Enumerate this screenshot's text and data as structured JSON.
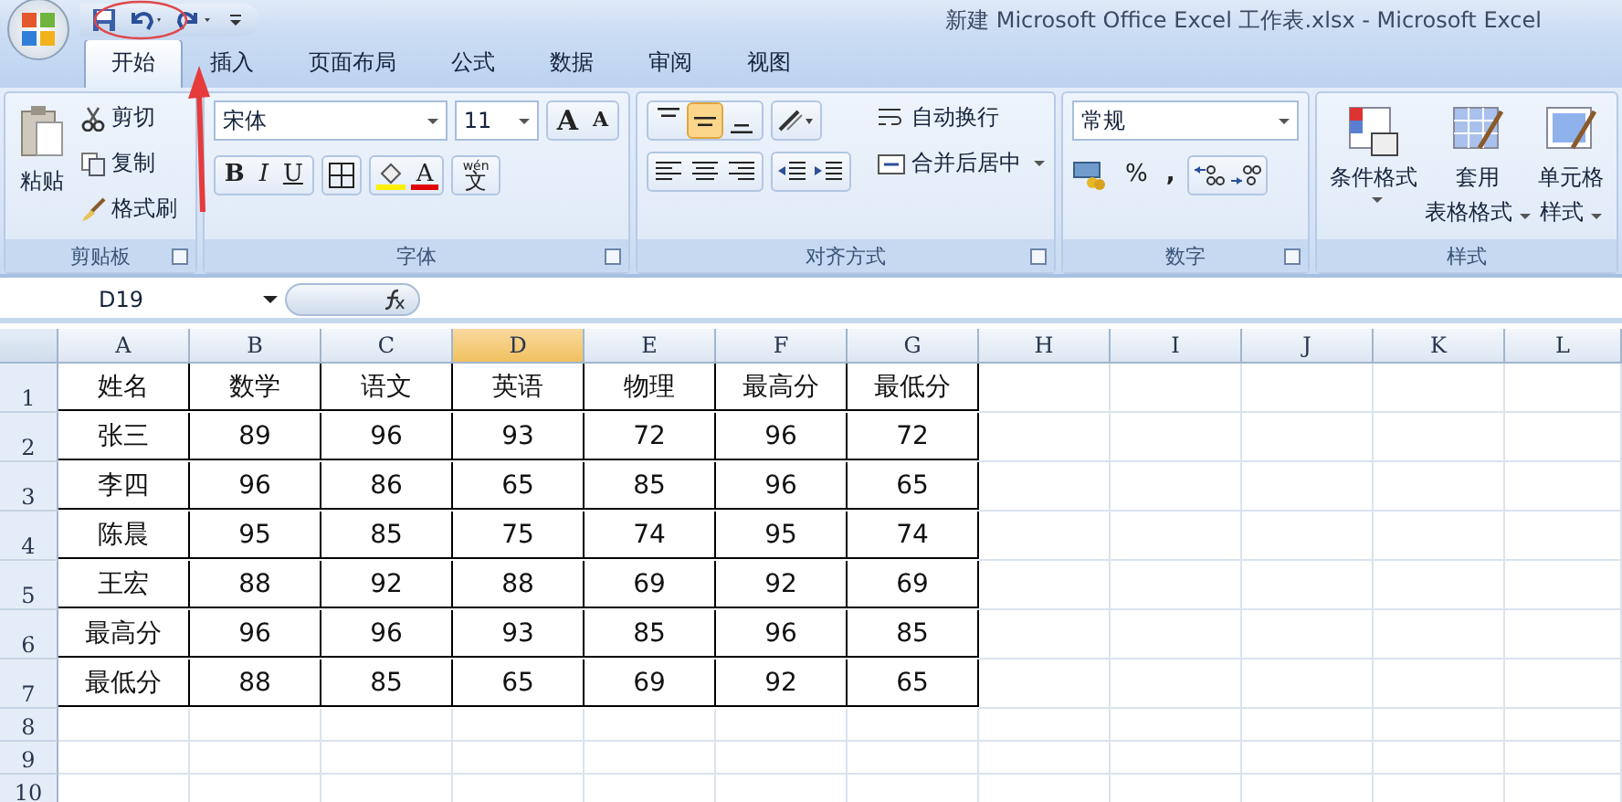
{
  "window": {
    "title": "新建 Microsoft Office Excel 工作表.xlsx - Microsoft Excel"
  },
  "tabs": [
    {
      "label": "开始",
      "selected": true
    },
    {
      "label": "插入",
      "selected": false
    },
    {
      "label": "页面布局",
      "selected": false
    },
    {
      "label": "公式",
      "selected": false
    },
    {
      "label": "数据",
      "selected": false
    },
    {
      "label": "审阅",
      "selected": false
    },
    {
      "label": "视图",
      "selected": false
    }
  ],
  "ribbon": {
    "clipboard": {
      "title": "剪贴板",
      "paste": "粘贴",
      "cut": "剪切",
      "copy": "复制",
      "format_painter": "格式刷"
    },
    "font": {
      "title": "字体",
      "font_name": "宋体",
      "font_size": "11",
      "grow": "A",
      "shrink": "A",
      "bold": "B",
      "italic": "I",
      "underline": "U",
      "font_color": "A",
      "phonetic_top": "wén",
      "phonetic": "文"
    },
    "alignment": {
      "title": "对齐方式",
      "vertical": [
        {
          "kind": "top",
          "selected": false
        },
        {
          "kind": "middle",
          "selected": true
        },
        {
          "kind": "bottom",
          "selected": false
        }
      ],
      "wrap_text": "自动换行",
      "merge_center": "合并后居中"
    },
    "number": {
      "title": "数字",
      "format": "常规",
      "percent": "%",
      "comma": ","
    },
    "styles": {
      "title": "样式",
      "conditional": "条件格式",
      "table_format": [
        "套用",
        "表格格式"
      ],
      "cell_styles": [
        "单元格",
        "样式"
      ]
    }
  },
  "name_box": "D19",
  "columns": [
    {
      "label": "A",
      "selected": false
    },
    {
      "label": "B",
      "selected": false
    },
    {
      "label": "C",
      "selected": false
    },
    {
      "label": "D",
      "selected": true
    },
    {
      "label": "E",
      "selected": false
    },
    {
      "label": "F",
      "selected": false
    },
    {
      "label": "G",
      "selected": false
    },
    {
      "label": "H",
      "selected": false
    },
    {
      "label": "I",
      "selected": false
    },
    {
      "label": "J",
      "selected": false
    },
    {
      "label": "K",
      "selected": false
    },
    {
      "label": "L",
      "selected": false
    }
  ],
  "rows": [
    {
      "number": "1",
      "cells": [
        "姓名",
        "数学",
        "语文",
        "英语",
        "物理",
        "最高分",
        "最低分"
      ]
    },
    {
      "number": "2",
      "cells": [
        "张三",
        "89",
        "96",
        "93",
        "72",
        "96",
        "72"
      ]
    },
    {
      "number": "3",
      "cells": [
        "李四",
        "96",
        "86",
        "65",
        "85",
        "96",
        "65"
      ]
    },
    {
      "number": "4",
      "cells": [
        "陈晨",
        "95",
        "85",
        "75",
        "74",
        "95",
        "74"
      ]
    },
    {
      "number": "5",
      "cells": [
        "王宏",
        "88",
        "92",
        "88",
        "69",
        "92",
        "69"
      ]
    },
    {
      "number": "6",
      "cells": [
        "最高分",
        "96",
        "96",
        "93",
        "85",
        "96",
        "85"
      ]
    },
    {
      "number": "7",
      "cells": [
        "最低分",
        "88",
        "85",
        "65",
        "69",
        "92",
        "65"
      ]
    },
    {
      "number": "8",
      "cells": []
    },
    {
      "number": "9",
      "cells": []
    },
    {
      "number": "10",
      "cells": []
    }
  ]
}
